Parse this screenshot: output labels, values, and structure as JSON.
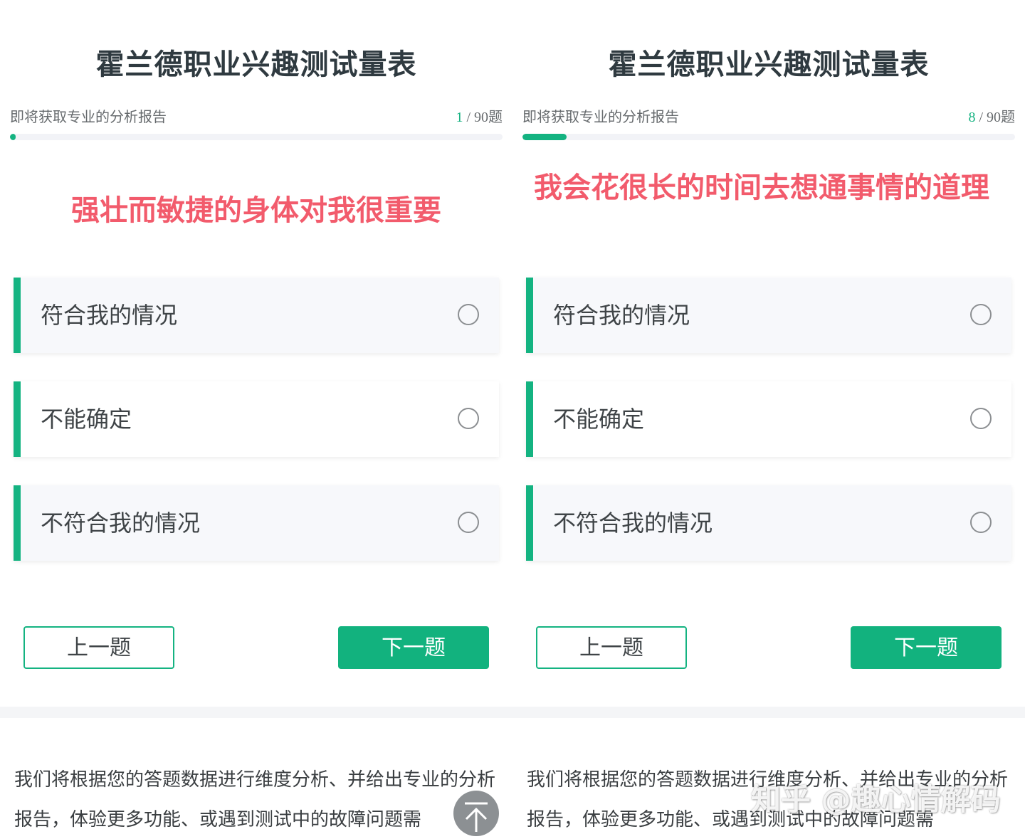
{
  "colors": {
    "accent": "#14b381",
    "question": "#f25b6c",
    "title": "#2f3a40"
  },
  "panels": [
    {
      "title": "霍兰德职业兴趣测试量表",
      "progress_label": "即将获取专业的分析报告",
      "progress": {
        "current": "1",
        "total_text": " / 90题",
        "fraction": 0.011
      },
      "question": "强壮而敏捷的身体对我很重要",
      "options": [
        "符合我的情况",
        "不能确定",
        "不符合我的情况"
      ],
      "prev_label": "上一题",
      "next_label": "下一题",
      "footer": "我们将根据您的答题数据进行维度分析、并给出专业的分析报告，体验更多功能、或遇到测试中的故障问题需",
      "scroll_top_icon": "arrow-up-icon"
    },
    {
      "title": "霍兰德职业兴趣测试量表",
      "progress_label": "即将获取专业的分析报告",
      "progress": {
        "current": "8",
        "total_text": " / 90题",
        "fraction": 0.089
      },
      "question": "我会花很长的时间去想通事情的道理",
      "options": [
        "符合我的情况",
        "不能确定",
        "不符合我的情况"
      ],
      "prev_label": "上一题",
      "next_label": "下一题",
      "footer": "我们将根据您的答题数据进行维度分析、并给出专业的分析报告，体验更多功能、或遇到测试中的故障问题需",
      "watermark": "知乎 @趣心情解码"
    }
  ]
}
